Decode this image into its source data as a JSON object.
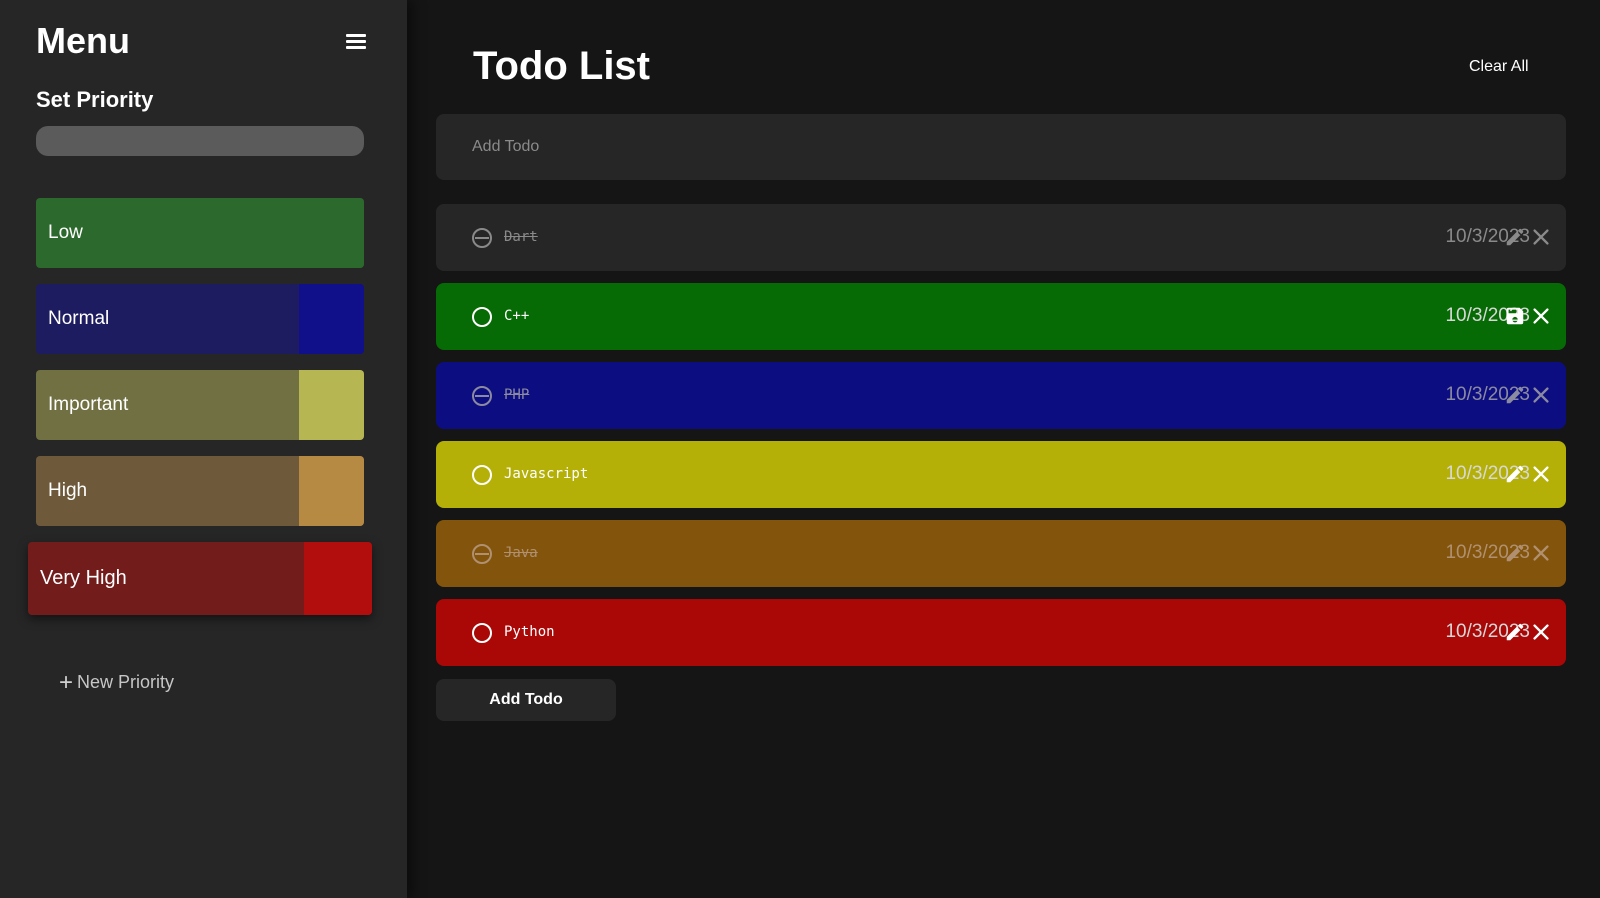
{
  "sidebar": {
    "title": "Menu",
    "set_priority_label": "Set Priority",
    "priority_input_value": "",
    "priorities": [
      {
        "label": "Low",
        "bg": "#2c692c",
        "swatch": "#2c692c"
      },
      {
        "label": "Normal",
        "bg": "#1e1c60",
        "swatch": "#10108a"
      },
      {
        "label": "Important",
        "bg": "#707042",
        "swatch": "#b6b652"
      },
      {
        "label": "High",
        "bg": "#6e5a3a",
        "swatch": "#b68a42"
      },
      {
        "label": "Very High",
        "bg": "#731c1c",
        "swatch": "#b20e0e",
        "selected": true
      }
    ],
    "new_priority_label": "New Priority"
  },
  "main": {
    "title": "Todo List",
    "clear_all_label": "Clear All",
    "add_input_placeholder": "Add Todo",
    "add_button_label": "Add Todo",
    "todos": [
      {
        "text": "Dart",
        "date": "10/3/2023",
        "bg": "#262626",
        "fg": "#8a8a8a",
        "done": true,
        "editing": false
      },
      {
        "text": "C++",
        "date": "10/3/2023",
        "bg": "#066a05",
        "fg": "#ffffff",
        "done": false,
        "editing": true
      },
      {
        "text": "PHP",
        "date": "10/3/2023",
        "bg": "#0d0d82",
        "fg": "#8a8aa0",
        "done": true,
        "editing": false
      },
      {
        "text": "Javascript",
        "date": "10/3/2023",
        "bg": "#b4b008",
        "fg": "#ffffff",
        "done": false,
        "editing": false
      },
      {
        "text": "Java",
        "date": "10/3/2023",
        "bg": "#82540c",
        "fg": "#b09070",
        "done": true,
        "editing": false
      },
      {
        "text": "Python",
        "date": "10/3/2023",
        "bg": "#aa0707",
        "fg": "#ffffff",
        "done": false,
        "editing": false
      }
    ]
  }
}
